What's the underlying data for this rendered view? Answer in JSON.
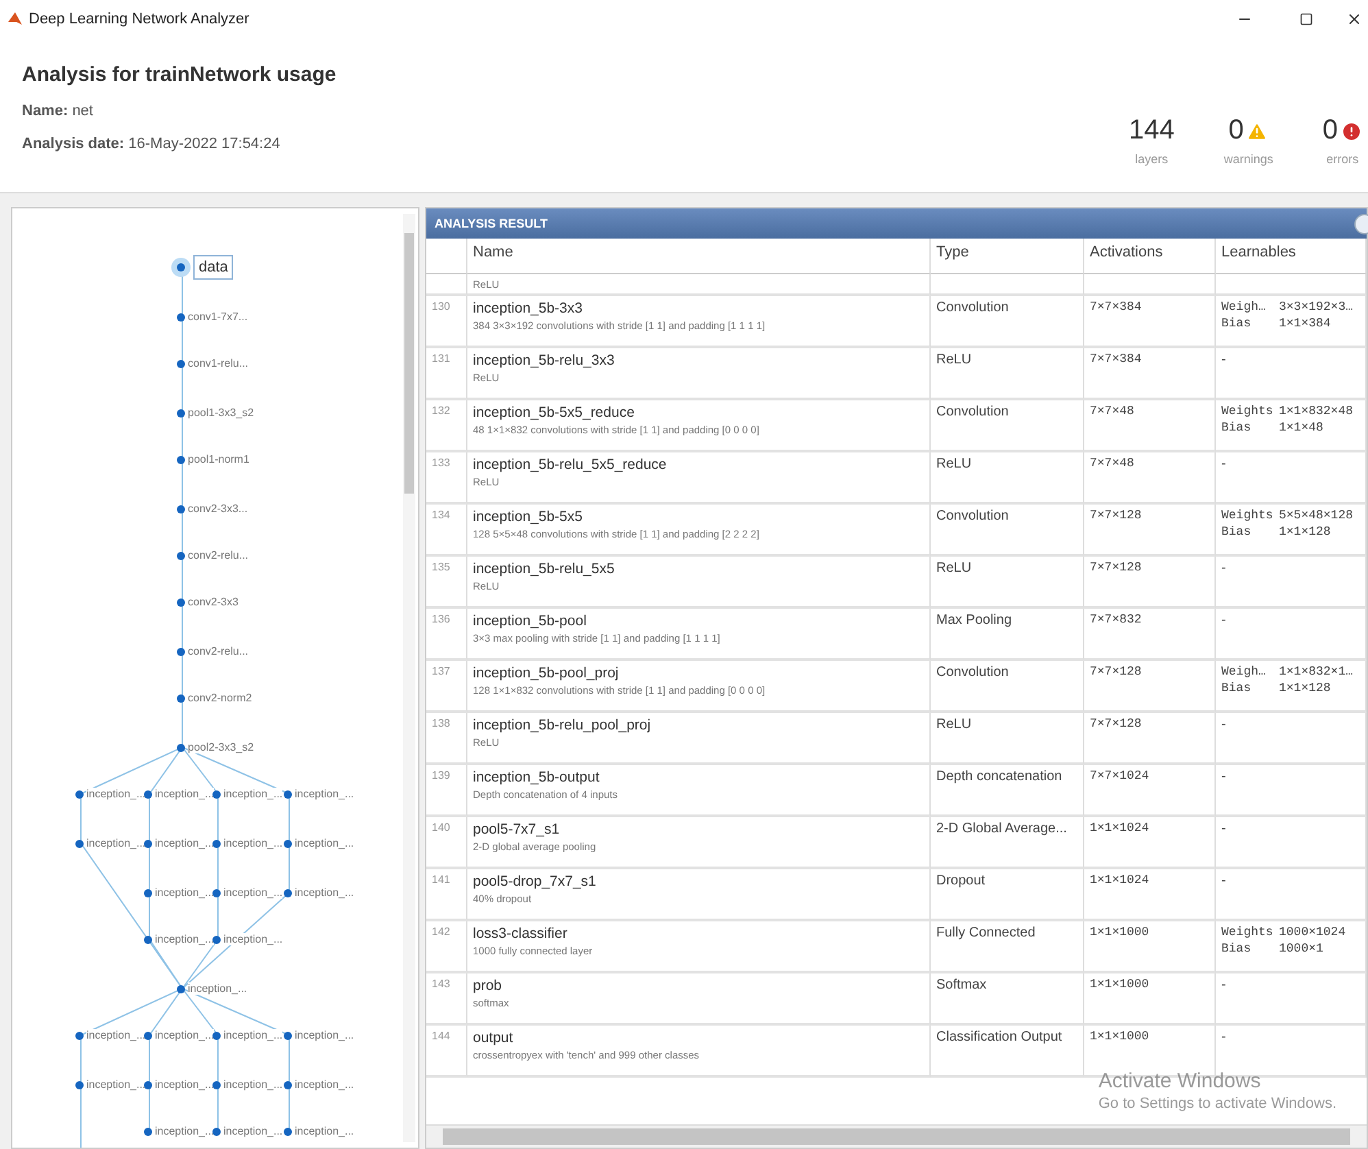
{
  "window": {
    "title": "Deep Learning Network Analyzer"
  },
  "header": {
    "title": "Analysis for trainNetwork usage",
    "name_label": "Name:",
    "name_value": "net",
    "date_label": "Analysis date:",
    "date_value": "16-May-2022 17:54:24"
  },
  "stats": [
    {
      "kind": "count",
      "value": "144",
      "label": "layers"
    },
    {
      "kind": "warning",
      "value": "0",
      "label": "warnings"
    },
    {
      "kind": "error",
      "value": "0",
      "label": "errors"
    }
  ],
  "graph": {
    "nodes": [
      {
        "label": "data",
        "selected": true
      },
      {
        "label": "conv1-7x7...",
        "selected": false
      },
      {
        "label": "conv1-relu...",
        "selected": false
      },
      {
        "label": "pool1-3x3_s2",
        "selected": false
      },
      {
        "label": "pool1-norm1",
        "selected": false
      },
      {
        "label": "conv2-3x3...",
        "selected": false
      },
      {
        "label": "conv2-relu...",
        "selected": false
      },
      {
        "label": "conv2-3x3",
        "selected": false
      },
      {
        "label": "conv2-relu...",
        "selected": false
      },
      {
        "label": "conv2-norm2",
        "selected": false
      },
      {
        "label": "pool2-3x3_s2",
        "selected": false
      },
      {
        "label": "inception_...",
        "selected": false
      },
      {
        "label": "inception_...",
        "selected": false
      },
      {
        "label": "inception_...",
        "selected": false
      },
      {
        "label": "inception_...",
        "selected": false
      },
      {
        "label": "inception_...",
        "selected": false
      },
      {
        "label": "inception_...",
        "selected": false
      },
      {
        "label": "inception_...",
        "selected": false
      },
      {
        "label": "inception_...",
        "selected": false
      },
      {
        "label": "inception_...",
        "selected": false
      },
      {
        "label": "inception_...",
        "selected": false
      },
      {
        "label": "inception_...",
        "selected": false
      },
      {
        "label": "inception_...",
        "selected": false
      },
      {
        "label": "inception_...",
        "selected": false
      },
      {
        "label": "inception_...",
        "selected": false
      },
      {
        "label": "inception_...",
        "selected": false
      },
      {
        "label": "inception_...",
        "selected": false
      },
      {
        "label": "inception_...",
        "selected": false
      },
      {
        "label": "inception_...",
        "selected": false
      },
      {
        "label": "inception_...",
        "selected": false
      },
      {
        "label": "inception_...",
        "selected": false
      },
      {
        "label": "inception_...",
        "selected": false
      },
      {
        "label": "inception_...",
        "selected": false
      },
      {
        "label": "inception_...",
        "selected": false
      },
      {
        "label": "inception_...",
        "selected": false
      },
      {
        "label": "inception_...",
        "selected": false
      }
    ]
  },
  "results": {
    "title": "ANALYSIS RESULT",
    "columns": [
      "Name",
      "Type",
      "Activations",
      "Learnables"
    ],
    "partial_row": {
      "description": "ReLU"
    },
    "rows": [
      {
        "number": "130",
        "name": "inception_5b-3x3",
        "description": "384 3×3×192 convolutions with stride [1 1] and padding [1 1 1 1]",
        "type": "Convolution",
        "activations": "7×7×384",
        "learnables": [
          [
            "Weigh…",
            "3×3×192×3…"
          ],
          [
            "Bias",
            "1×1×384"
          ]
        ]
      },
      {
        "number": "131",
        "name": "inception_5b-relu_3x3",
        "description": "ReLU",
        "type": "ReLU",
        "activations": "7×7×384",
        "learnables": "-"
      },
      {
        "number": "132",
        "name": "inception_5b-5x5_reduce",
        "description": "48 1×1×832 convolutions with stride [1 1] and padding [0 0 0 0]",
        "type": "Convolution",
        "activations": "7×7×48",
        "learnables": [
          [
            "Weights",
            "1×1×832×48"
          ],
          [
            "Bias",
            "1×1×48"
          ]
        ]
      },
      {
        "number": "133",
        "name": "inception_5b-relu_5x5_reduce",
        "description": "ReLU",
        "type": "ReLU",
        "activations": "7×7×48",
        "learnables": "-"
      },
      {
        "number": "134",
        "name": "inception_5b-5x5",
        "description": "128 5×5×48 convolutions with stride [1 1] and padding [2 2 2 2]",
        "type": "Convolution",
        "activations": "7×7×128",
        "learnables": [
          [
            "Weights",
            "5×5×48×128"
          ],
          [
            "Bias",
            "1×1×128"
          ]
        ]
      },
      {
        "number": "135",
        "name": "inception_5b-relu_5x5",
        "description": "ReLU",
        "type": "ReLU",
        "activations": "7×7×128",
        "learnables": "-"
      },
      {
        "number": "136",
        "name": "inception_5b-pool",
        "description": "3×3 max pooling with stride [1 1] and padding [1 1 1 1]",
        "type": "Max Pooling",
        "activations": "7×7×832",
        "learnables": "-"
      },
      {
        "number": "137",
        "name": "inception_5b-pool_proj",
        "description": "128 1×1×832 convolutions with stride [1 1] and padding [0 0 0 0]",
        "type": "Convolution",
        "activations": "7×7×128",
        "learnables": [
          [
            "Weigh…",
            "1×1×832×1…"
          ],
          [
            "Bias",
            "1×1×128"
          ]
        ]
      },
      {
        "number": "138",
        "name": "inception_5b-relu_pool_proj",
        "description": "ReLU",
        "type": "ReLU",
        "activations": "7×7×128",
        "learnables": "-"
      },
      {
        "number": "139",
        "name": "inception_5b-output",
        "description": "Depth concatenation of 4 inputs",
        "type": "Depth concatenation",
        "activations": "7×7×1024",
        "learnables": "-"
      },
      {
        "number": "140",
        "name": "pool5-7x7_s1",
        "description": "2-D global average pooling",
        "type": "2-D Global Average...",
        "activations": "1×1×1024",
        "learnables": "-"
      },
      {
        "number": "141",
        "name": "pool5-drop_7x7_s1",
        "description": "40% dropout",
        "type": "Dropout",
        "activations": "1×1×1024",
        "learnables": "-"
      },
      {
        "number": "142",
        "name": "loss3-classifier",
        "description": "1000 fully connected layer",
        "type": "Fully Connected",
        "activations": "1×1×1000",
        "learnables": [
          [
            "Weights",
            "1000×1024"
          ],
          [
            "Bias",
            "1000×1"
          ]
        ]
      },
      {
        "number": "143",
        "name": "prob",
        "description": "softmax",
        "type": "Softmax",
        "activations": "1×1×1000",
        "learnables": "-"
      },
      {
        "number": "144",
        "name": "output",
        "description": "crossentropyex with 'tench' and 999 other classes",
        "type": "Classification Output",
        "activations": "1×1×1000",
        "learnables": "-"
      }
    ]
  },
  "os_overlay": {
    "title": "Activate Windows",
    "message": "Go to Settings to activate Windows."
  }
}
